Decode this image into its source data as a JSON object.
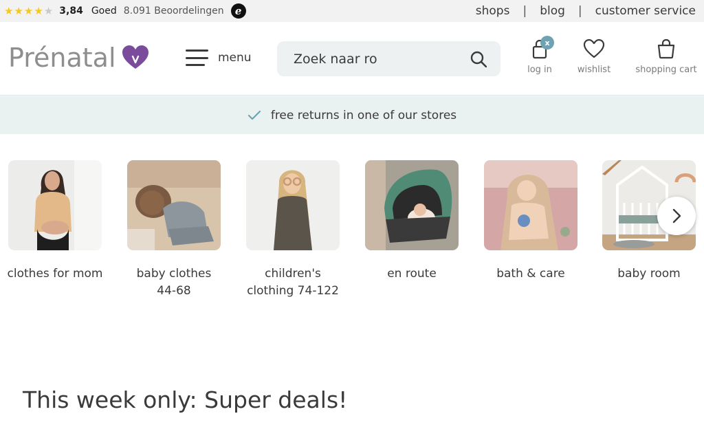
{
  "rating": {
    "stars_filled": 4,
    "stars_total": 5,
    "score": "3,84",
    "grade": "Goed",
    "reviews": "8.091 Beoordelingen",
    "badge_letter": "e"
  },
  "top_links": [
    "shops",
    "blog",
    "customer service"
  ],
  "top_separator": "|",
  "logo": {
    "text": "Prénatal",
    "color": "#8e8e8e",
    "heart_color": "#7b4c9c"
  },
  "menu": {
    "label": "menu"
  },
  "search": {
    "value": "Zoek naar ro",
    "icon": "search-icon"
  },
  "header_actions": [
    {
      "label": "log in",
      "icon": "user-icon",
      "badge": "x"
    },
    {
      "label": "wishlist",
      "icon": "heart-icon"
    },
    {
      "label": "shopping cart",
      "icon": "bag-icon"
    }
  ],
  "notice": {
    "text": "free returns in one of our stores",
    "icon": "check-icon"
  },
  "categories": [
    {
      "label": "clothes for mom"
    },
    {
      "label": "baby clothes 44-68"
    },
    {
      "label": "children's clothing 74-122"
    },
    {
      "label": "en route"
    },
    {
      "label": "bath & care"
    },
    {
      "label": "baby room"
    }
  ],
  "carousel": {
    "next_icon": "chevron-right-icon"
  },
  "deals": {
    "title": "This week only: Super deals!"
  },
  "colors": {
    "accent": "#6fa3b3",
    "notice_bg": "#e9f1f1",
    "star": "#f5c81e"
  }
}
